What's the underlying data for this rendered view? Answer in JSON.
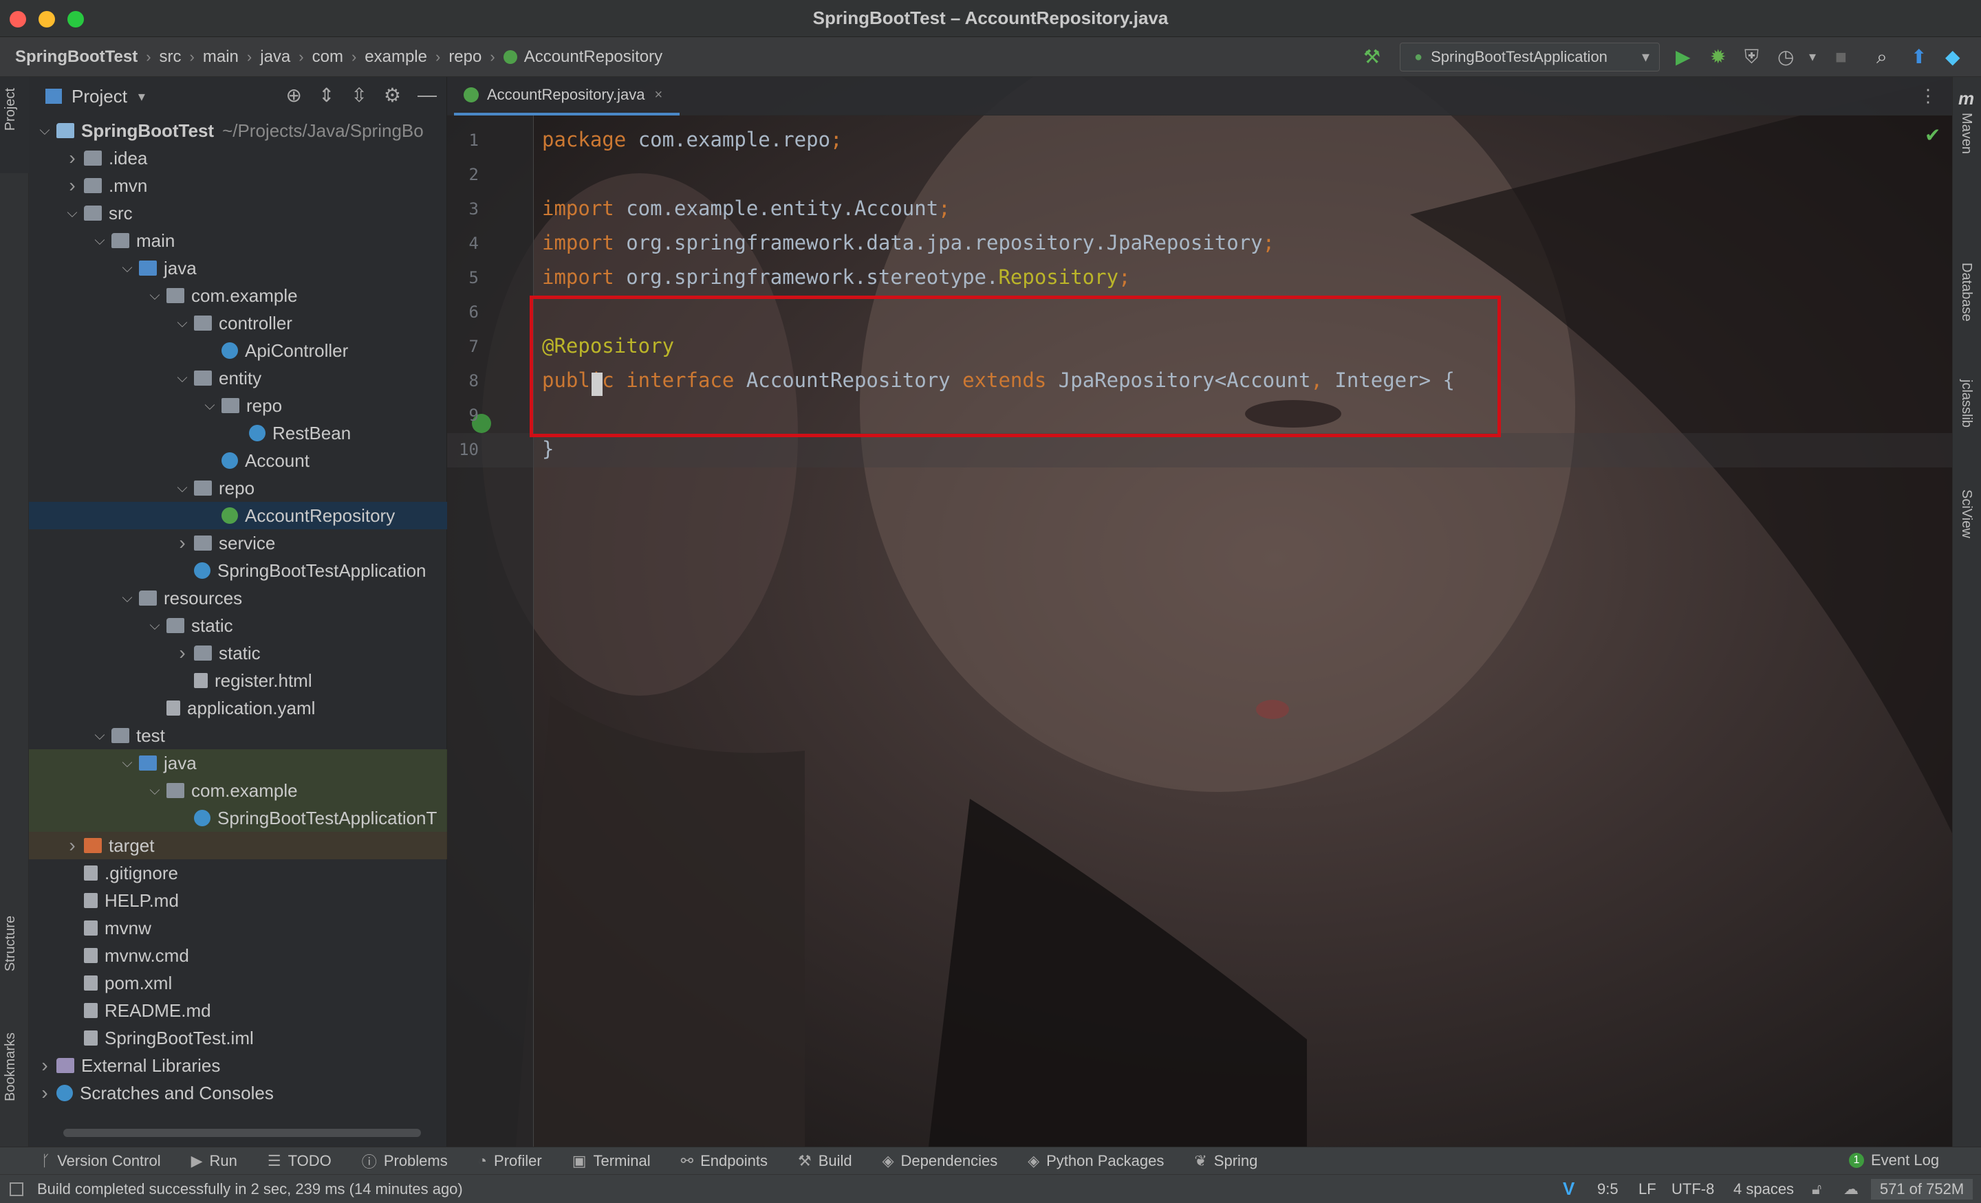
{
  "window": {
    "title": "SpringBootTest – AccountRepository.java"
  },
  "breadcrumb": {
    "project": "SpringBootTest",
    "items": [
      "src",
      "main",
      "java",
      "com",
      "example",
      "repo"
    ],
    "current": "AccountRepository"
  },
  "toolbar": {
    "run_config": "SpringBootTestApplication"
  },
  "left_strip": {
    "project_tab": "Project",
    "structure_tab": "Structure",
    "bookmarks_tab": "Bookmarks"
  },
  "right_strip": {
    "maven": "Maven",
    "database": "Database",
    "jclasslib": "jclasslib",
    "sciview": "SciView"
  },
  "project_panel": {
    "title": "Project",
    "tree": [
      {
        "label": "SpringBootTest",
        "hint": "~/Projects/Java/SpringBo",
        "depth": 0,
        "arrow": "down",
        "icon": "module",
        "bold": true
      },
      {
        "label": ".idea",
        "depth": 1,
        "arrow": "right",
        "icon": "folder"
      },
      {
        "label": ".mvn",
        "depth": 1,
        "arrow": "right",
        "icon": "folder"
      },
      {
        "label": "src",
        "depth": 1,
        "arrow": "down",
        "icon": "folder"
      },
      {
        "label": "main",
        "depth": 2,
        "arrow": "down",
        "icon": "folder"
      },
      {
        "label": "java",
        "depth": 3,
        "arrow": "down",
        "icon": "bluefolder"
      },
      {
        "label": "com.example",
        "depth": 4,
        "arrow": "down",
        "icon": "pkg"
      },
      {
        "label": "controller",
        "depth": 5,
        "arrow": "down",
        "icon": "pkg"
      },
      {
        "label": "ApiController",
        "depth": 6,
        "icon": "cls"
      },
      {
        "label": "entity",
        "depth": 5,
        "arrow": "down",
        "icon": "pkg"
      },
      {
        "label": "repo",
        "depth": 6,
        "arrow": "down",
        "icon": "pkg"
      },
      {
        "label": "RestBean",
        "depth": 7,
        "icon": "cls"
      },
      {
        "label": "Account",
        "depth": 6,
        "icon": "cls"
      },
      {
        "label": "repo",
        "depth": 5,
        "arrow": "down",
        "icon": "pkg"
      },
      {
        "label": "AccountRepository",
        "depth": 6,
        "icon": "intf",
        "selected": true
      },
      {
        "label": "service",
        "depth": 5,
        "arrow": "right",
        "icon": "pkg"
      },
      {
        "label": "SpringBootTestApplication",
        "depth": 5,
        "icon": "cls"
      },
      {
        "label": "resources",
        "depth": 3,
        "arrow": "down",
        "icon": "folder"
      },
      {
        "label": "static",
        "depth": 4,
        "arrow": "down",
        "icon": "folder"
      },
      {
        "label": "static",
        "depth": 5,
        "arrow": "right",
        "icon": "folder"
      },
      {
        "label": "register.html",
        "depth": 5,
        "icon": "file"
      },
      {
        "label": "application.yaml",
        "depth": 4,
        "icon": "file"
      },
      {
        "label": "test",
        "depth": 2,
        "arrow": "down",
        "icon": "folder"
      },
      {
        "label": "java",
        "depth": 3,
        "arrow": "down",
        "icon": "bluefolder",
        "test": true
      },
      {
        "label": "com.example",
        "depth": 4,
        "arrow": "down",
        "icon": "pkg",
        "test": true
      },
      {
        "label": "SpringBootTestApplicationT",
        "depth": 5,
        "icon": "cls",
        "test": true
      },
      {
        "label": "target",
        "depth": 1,
        "arrow": "right",
        "icon": "orangefolder",
        "target": true
      },
      {
        "label": ".gitignore",
        "depth": 1,
        "icon": "file"
      },
      {
        "label": "HELP.md",
        "depth": 1,
        "icon": "file"
      },
      {
        "label": "mvnw",
        "depth": 1,
        "icon": "file"
      },
      {
        "label": "mvnw.cmd",
        "depth": 1,
        "icon": "file"
      },
      {
        "label": "pom.xml",
        "depth": 1,
        "icon": "file"
      },
      {
        "label": "README.md",
        "depth": 1,
        "icon": "file"
      },
      {
        "label": "SpringBootTest.iml",
        "depth": 1,
        "icon": "file"
      },
      {
        "label": "External Libraries",
        "depth": 0,
        "arrow": "right",
        "icon": "lib"
      },
      {
        "label": "Scratches and Consoles",
        "depth": 0,
        "arrow": "right",
        "icon": "scratch"
      }
    ]
  },
  "editor": {
    "tab_label": "AccountRepository.java",
    "lines": [
      {
        "n": "1",
        "tokens": [
          {
            "t": "package ",
            "c": "kw"
          },
          {
            "t": "com.example.repo",
            "c": ""
          },
          {
            "t": ";",
            "c": "kw"
          }
        ]
      },
      {
        "n": "2",
        "tokens": []
      },
      {
        "n": "3",
        "tokens": [
          {
            "t": "import ",
            "c": "kw"
          },
          {
            "t": "com.example.entity.Account",
            "c": ""
          },
          {
            "t": ";",
            "c": "kw"
          }
        ]
      },
      {
        "n": "4",
        "tokens": [
          {
            "t": "import ",
            "c": "kw"
          },
          {
            "t": "org.springframework.data.jpa.repository.JpaRepository",
            "c": ""
          },
          {
            "t": ";",
            "c": "kw"
          }
        ]
      },
      {
        "n": "5",
        "tokens": [
          {
            "t": "import ",
            "c": "kw"
          },
          {
            "t": "org.springframework.stereotype.",
            "c": ""
          },
          {
            "t": "Repository",
            "c": "ann"
          },
          {
            "t": ";",
            "c": "kw"
          }
        ]
      },
      {
        "n": "6",
        "tokens": []
      },
      {
        "n": "7",
        "tokens": [
          {
            "t": "@Repository",
            "c": "ann"
          }
        ]
      },
      {
        "n": "8",
        "tokens": [
          {
            "t": "public interface ",
            "c": "kw"
          },
          {
            "t": "AccountRepository ",
            "c": ""
          },
          {
            "t": "extends ",
            "c": "kw"
          },
          {
            "t": "JpaRepository<Account",
            "c": ""
          },
          {
            "t": ", ",
            "c": "kw"
          },
          {
            "t": "Integer> {",
            "c": ""
          }
        ]
      },
      {
        "n": "9",
        "tokens": []
      },
      {
        "n": "10",
        "tokens": [
          {
            "t": "}",
            "c": ""
          }
        ]
      }
    ]
  },
  "bottom_tools": [
    "Version Control",
    "Run",
    "TODO",
    "Problems",
    "Profiler",
    "Terminal",
    "Endpoints",
    "Build",
    "Dependencies",
    "Python Packages",
    "Spring"
  ],
  "event_log": "Event Log",
  "status": {
    "message": "Build completed successfully in 2 sec, 239 ms (14 minutes ago)",
    "position": "9:5",
    "line_sep": "LF",
    "encoding": "UTF-8",
    "indent": "4 spaces",
    "memory": "571 of 752M"
  }
}
